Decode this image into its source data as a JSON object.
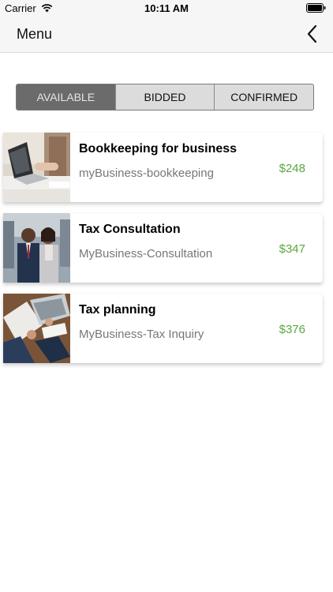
{
  "status_bar": {
    "carrier": "Carrier",
    "time": "10:11 AM",
    "wifi_icon": "wifi-icon",
    "battery_icon": "battery-icon"
  },
  "nav": {
    "title": "Menu",
    "back_icon": "chevron-left-icon"
  },
  "tabs": [
    {
      "label": "AVAILABLE",
      "active": true
    },
    {
      "label": "BIDDED",
      "active": false
    },
    {
      "label": "CONFIRMED",
      "active": false
    }
  ],
  "colors": {
    "price": "#5aa83f",
    "active_tab_bg": "#6b6b6b",
    "inactive_tab_bg": "#dcdcdc"
  },
  "services": [
    {
      "title": "Bookkeeping for business",
      "subtitle": "myBusiness-bookkeeping",
      "price": "$248",
      "image": "laptop-office-photo"
    },
    {
      "title": "Tax Consultation",
      "subtitle": "MyBusiness-Consultation",
      "price": "$347",
      "image": "business-people-photo"
    },
    {
      "title": "Tax planning",
      "subtitle": "MyBusiness-Tax Inquiry",
      "price": "$376",
      "image": "desk-calculator-photo"
    }
  ]
}
